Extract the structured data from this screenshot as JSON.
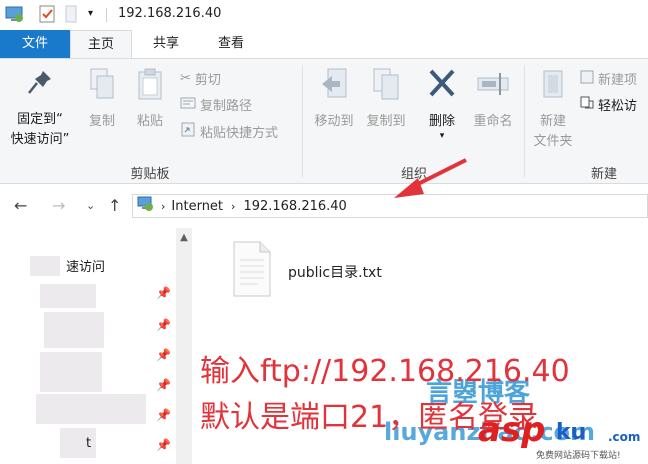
{
  "window": {
    "title": "192.168.216.40"
  },
  "quick_access": {
    "icons": [
      "computer-icon",
      "properties-icon",
      "folder-icon",
      "dropdown-icon"
    ]
  },
  "tabs": [
    {
      "label": "文件"
    },
    {
      "label": "主页"
    },
    {
      "label": "共享"
    },
    {
      "label": "查看"
    }
  ],
  "ribbon": {
    "clipboard": {
      "label": "剪贴板",
      "pin_line1": "固定到“",
      "pin_line2": "快速访问”",
      "copy": "复制",
      "paste": "粘贴",
      "cut": "剪切",
      "copy_path": "复制路径",
      "paste_shortcut": "粘贴快捷方式"
    },
    "organize": {
      "label": "组织",
      "move_to": "移动到",
      "copy_to": "复制到",
      "delete": "删除",
      "rename": "重命名"
    },
    "new": {
      "label": "新建",
      "new_folder_line1": "新建",
      "new_folder_line2": "文件夹",
      "new_item": "新建项",
      "easy_access": "轻松访"
    }
  },
  "address": {
    "segments": [
      "Internet",
      "192.168.216.40"
    ]
  },
  "nav_pane": {
    "quick_access": "速访问",
    "item_fragment": "t"
  },
  "files": [
    {
      "name": "public目录.txt"
    }
  ],
  "annotations": {
    "line1": "输入ftp://192.168.216.40",
    "line2": "默认是端口21，匿名登录"
  },
  "watermarks": {
    "cn": "言曌博客",
    "url": "liuyanzhao.com",
    "asp": "asp",
    "ku": "ku",
    "com": ".com",
    "sub": "免费网站源码下载站!"
  },
  "colors": {
    "file_tab": "#1979ca",
    "annotation": "#e2323a",
    "arrow": "#e2323a",
    "delete_icon": "#3c5a7a"
  }
}
